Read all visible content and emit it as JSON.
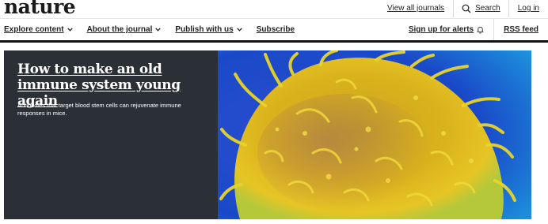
{
  "header": {
    "logo_text": "nature",
    "view_all_journals": "View all journals",
    "search": "Search",
    "login": "Log in"
  },
  "nav": {
    "explore_content": "Explore content",
    "about_the_journal": "About the journal",
    "publish_with_us": "Publish with us",
    "subscribe": "Subscribe",
    "sign_up_for_alerts": "Sign up for alerts",
    "rss_feed": "RSS feed"
  },
  "hero": {
    "title": "How to make an old immune system young again",
    "summary": "Antibodies that target blood stem cells can rejuvenate immune responses in mice.",
    "image_subject": "micrograph of a blood cell, yellow on blue"
  },
  "icons": [
    "search-icon",
    "chevron-down-icon",
    "bell-icon"
  ],
  "colors": {
    "hero_panel": "#2b2f36",
    "image_background": "#1f4fc0",
    "cell": "#e8c21a",
    "rule": "#111111"
  }
}
